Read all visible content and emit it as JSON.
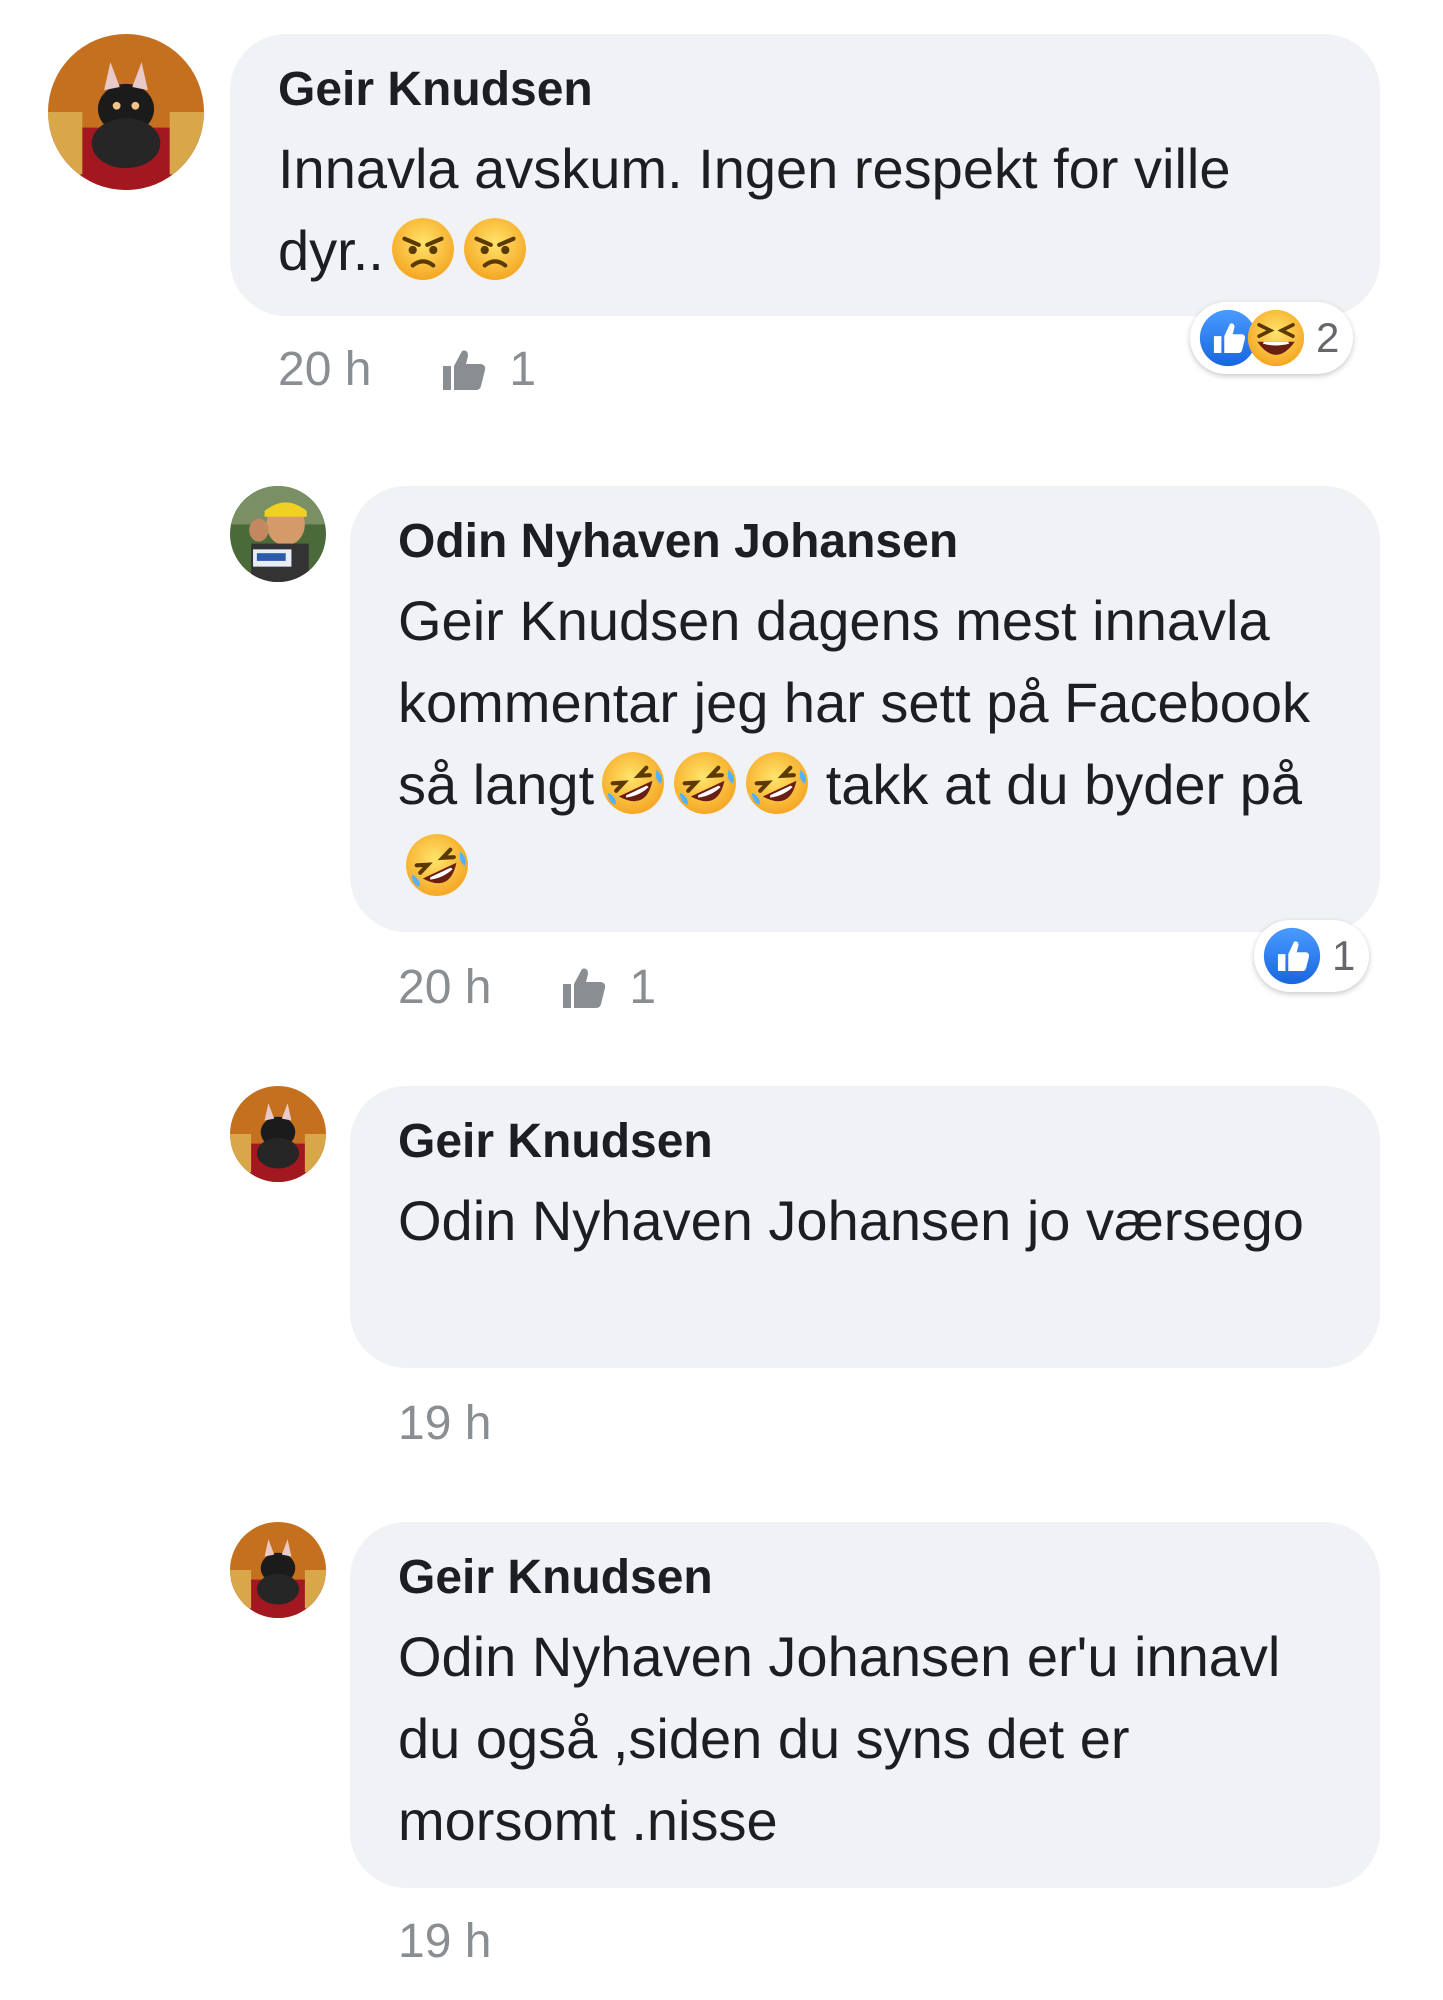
{
  "comments": [
    {
      "author": "Geir Knudsen",
      "text": "Innavla avskum. Ingen respekt for ville dyr..",
      "emoji": [
        "angry",
        "angry"
      ],
      "time": "20 h",
      "like_count": "1",
      "reactions": [
        "like",
        "haha"
      ],
      "reaction_count": "2"
    },
    {
      "author": "Odin Nyhaven Johansen",
      "text_line1": "Geir Knudsen dagens mest innavla kommentar jeg har sett på Facebook så langt",
      "text_line2": "takk at du byder på",
      "emoji": [
        "rofl",
        "rofl",
        "rofl",
        "rofl"
      ],
      "time": "20 h",
      "like_count": "1",
      "reactions": [
        "like"
      ],
      "reaction_count": "1"
    },
    {
      "author": "Geir Knudsen",
      "text": "Odin Nyhaven Johansen jo værsego",
      "time": "19 h"
    },
    {
      "author": "Geir Knudsen",
      "text": "Odin Nyhaven Johansen er'u innavl du også ,siden du syns det er morsomt .nisse",
      "time": "19 h"
    }
  ],
  "colors": {
    "bubble": "#f0f2f5",
    "meta": "#8a8d91",
    "like_blue": "#1877f2",
    "emoji_yellow": "#fbc02d"
  }
}
